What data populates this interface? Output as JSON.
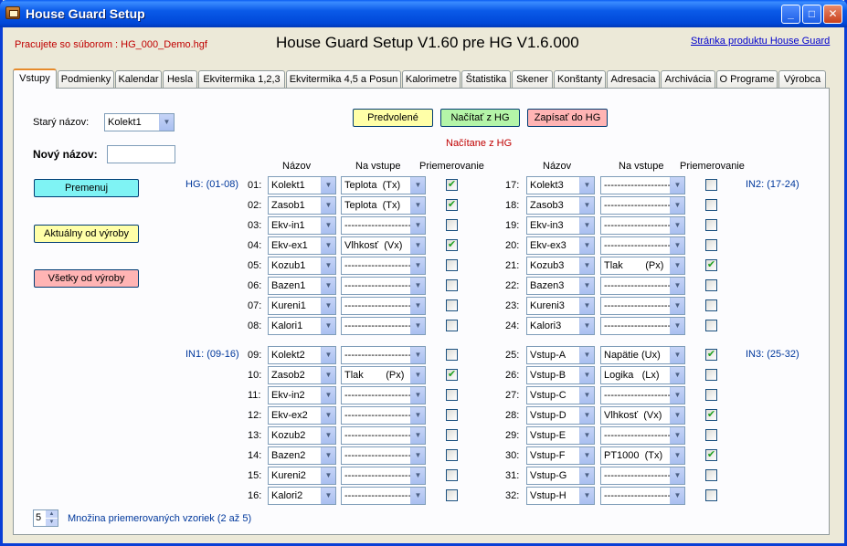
{
  "window": {
    "title": "House Guard Setup",
    "file_info": "Pracujete so súborom : HG_000_Demo.hgf",
    "app_title": "House Guard Setup V1.60 pre HG V1.6.000",
    "product_link": "Stránka produktu House Guard"
  },
  "tabs": [
    "Vstupy",
    "Podmienky",
    "Kalendar",
    "Hesla",
    "Ekvitermika 1,2,3",
    "Ekvitermika 4,5 a Posun",
    "Kalorimetre",
    "Štatistika",
    "Skener",
    "Konštanty",
    "Adresacia",
    "Archivácia",
    "O Programe",
    "Výrobca"
  ],
  "active_tab": "Vstupy",
  "left": {
    "old_name_label": "Starý názov:",
    "old_name_value": "Kolekt1",
    "new_name_label": "Nový názov:",
    "new_name_value": "",
    "rename_button": "Premenuj",
    "current_factory_button": "Aktuálny od výroby",
    "all_factory_button": "Všetky od výroby"
  },
  "top_buttons": {
    "default": "Predvolené",
    "load": "Načítať z HG",
    "write": "Zapísať do HG",
    "status": "Načítane z HG"
  },
  "headers": {
    "name": "Názov",
    "input": "Na vstupe",
    "averaging": "Priemerovanie"
  },
  "groups": {
    "g1": "HG: (01-08)",
    "g2": "IN1: (09-16)",
    "g3": "IN2: (17-24)",
    "g4": "IN3: (25-32)"
  },
  "rows": [
    {
      "num": "01:",
      "name": "Kolekt1",
      "input": "Teplota  (Tx)",
      "avg": true
    },
    {
      "num": "02:",
      "name": "Zasob1",
      "input": "Teplota  (Tx)",
      "avg": true
    },
    {
      "num": "03:",
      "name": "Ekv-in1",
      "input": "--------------------",
      "avg": false
    },
    {
      "num": "04:",
      "name": "Ekv-ex1",
      "input": "Vlhkosť  (Vx)",
      "avg": true
    },
    {
      "num": "05:",
      "name": "Kozub1",
      "input": "--------------------",
      "avg": false
    },
    {
      "num": "06:",
      "name": "Bazen1",
      "input": "--------------------",
      "avg": false
    },
    {
      "num": "07:",
      "name": "Kureni1",
      "input": "--------------------",
      "avg": false
    },
    {
      "num": "08:",
      "name": "Kalori1",
      "input": "--------------------",
      "avg": false
    },
    {
      "num": "09:",
      "name": "Kolekt2",
      "input": "--------------------",
      "avg": false
    },
    {
      "num": "10:",
      "name": "Zasob2",
      "input": "Tlak        (Px)",
      "avg": true
    },
    {
      "num": "11:",
      "name": "Ekv-in2",
      "input": "--------------------",
      "avg": false
    },
    {
      "num": "12:",
      "name": "Ekv-ex2",
      "input": "--------------------",
      "avg": false
    },
    {
      "num": "13:",
      "name": "Kozub2",
      "input": "--------------------",
      "avg": false
    },
    {
      "num": "14:",
      "name": "Bazen2",
      "input": "--------------------",
      "avg": false
    },
    {
      "num": "15:",
      "name": "Kureni2",
      "input": "--------------------",
      "avg": false
    },
    {
      "num": "16:",
      "name": "Kalori2",
      "input": "--------------------",
      "avg": false
    },
    {
      "num": "17:",
      "name": "Kolekt3",
      "input": "--------------------",
      "avg": false
    },
    {
      "num": "18:",
      "name": "Zasob3",
      "input": "--------------------",
      "avg": false
    },
    {
      "num": "19:",
      "name": "Ekv-in3",
      "input": "--------------------",
      "avg": false
    },
    {
      "num": "20:",
      "name": "Ekv-ex3",
      "input": "--------------------",
      "avg": false
    },
    {
      "num": "21:",
      "name": "Kozub3",
      "input": "Tlak        (Px)",
      "avg": true
    },
    {
      "num": "22:",
      "name": "Bazen3",
      "input": "--------------------",
      "avg": false
    },
    {
      "num": "23:",
      "name": "Kureni3",
      "input": "--------------------",
      "avg": false
    },
    {
      "num": "24:",
      "name": "Kalori3",
      "input": "--------------------",
      "avg": false
    },
    {
      "num": "25:",
      "name": "Vstup-A",
      "input": "Napätie (Ux)",
      "avg": true
    },
    {
      "num": "26:",
      "name": "Vstup-B",
      "input": "Logika   (Lx)",
      "avg": false
    },
    {
      "num": "27:",
      "name": "Vstup-C",
      "input": "--------------------",
      "avg": false
    },
    {
      "num": "28:",
      "name": "Vstup-D",
      "input": "Vlhkosť  (Vx)",
      "avg": true
    },
    {
      "num": "29:",
      "name": "Vstup-E",
      "input": "--------------------",
      "avg": false
    },
    {
      "num": "30:",
      "name": "Vstup-F",
      "input": "PT1000  (Tx)",
      "avg": true
    },
    {
      "num": "31:",
      "name": "Vstup-G",
      "input": "--------------------",
      "avg": false
    },
    {
      "num": "32:",
      "name": "Vstup-H",
      "input": "--------------------",
      "avg": false
    }
  ],
  "footer": {
    "spin_value": "5",
    "spin_label": "Množina priemerovaných vzoriek (2 až 5)"
  },
  "colors": {
    "title_bar": "#0a5ae8",
    "accent_tab": "#e68b2c",
    "status_red": "#c00000",
    "group_blue": "#00389c"
  }
}
